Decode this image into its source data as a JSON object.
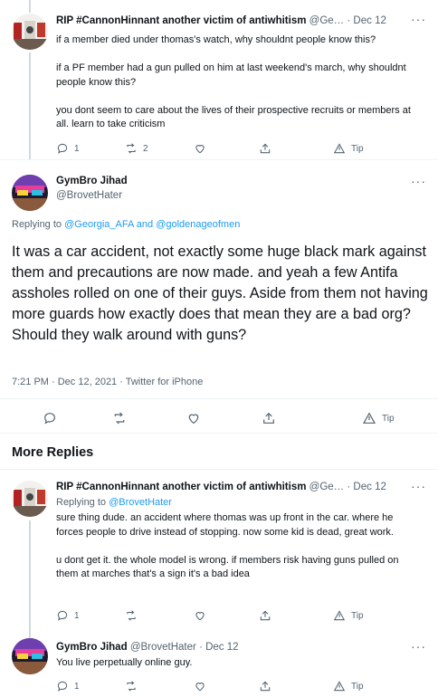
{
  "top_tweet": {
    "name": "RIP #CannonHinnant another victim of antiwhitism",
    "handle": "@Ge…",
    "dot": "·",
    "date": "Dec 12",
    "paragraphs": [
      "if a member died under thomas's watch, why shouldnt people know this?",
      "if a PF member had a gun pulled on him at last weekend's march, why shouldnt people know this?",
      "you dont seem to care about the lives of their prospective recruits or members at all. learn to take criticism"
    ],
    "reply_count": "1",
    "retweet_count": "2",
    "like_count": "",
    "tip_label": "Tip"
  },
  "main_tweet": {
    "name": "GymBro Jihad",
    "handle": "@BrovetHater",
    "replying_prefix": "Replying to",
    "replying_user1": "@Georgia_AFA",
    "replying_and": "and",
    "replying_user2": "@goldenageofmen",
    "text": "It was a car accident, not exactly some huge black mark against them and precautions are now made. and yeah a few Antifa assholes rolled on one of their guys. Aside from them not having more guards how exactly does that mean they are a bad org? Should they walk around with guns?",
    "meta": "7:21 PM · Dec 12, 2021 · Twitter for iPhone",
    "tip_label": "Tip"
  },
  "more_replies_title": "More Replies",
  "reply1": {
    "name": "RIP #CannonHinnant another victim of antiwhitism",
    "handle": "@Ge…",
    "dot": "·",
    "date": "Dec 12",
    "replying_prefix": "Replying to",
    "replying_user": "@BrovetHater",
    "paragraphs": [
      "sure thing dude. an accident where thomas was up front in the car. where he forces people to drive instead of stopping. now some kid is dead, great work.",
      "u dont get it. the whole model is wrong. if members risk having guns pulled on them at marches that's a sign it's a bad idea"
    ],
    "reply_count": "1",
    "tip_label": "Tip"
  },
  "reply2": {
    "name": "GymBro Jihad",
    "handle": "@BrovetHater",
    "dot": "·",
    "date": "Dec 12",
    "text": "You live perpetually online guy.",
    "reply_count": "1",
    "tip_label": "Tip"
  },
  "icons": {
    "reply": "reply-icon",
    "retweet": "retweet-icon",
    "like": "heart-icon",
    "share": "share-icon",
    "tip": "tip-icon",
    "more": "more-icon"
  },
  "colors": {
    "link": "#1d9bf0",
    "secondary_text": "#536471",
    "primary_text": "#0f1419"
  }
}
